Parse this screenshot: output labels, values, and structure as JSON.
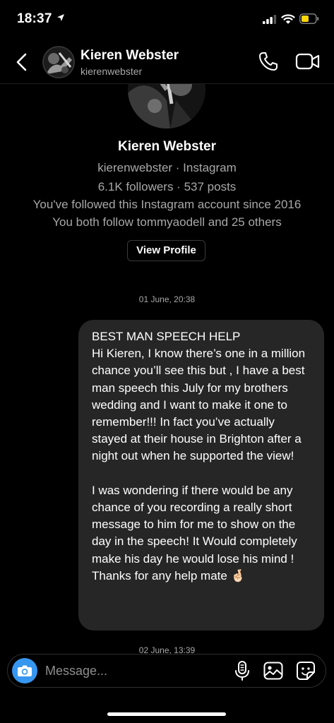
{
  "status_bar": {
    "time": "18:37"
  },
  "header": {
    "name": "Kieren Webster",
    "username": "kierenwebster"
  },
  "profile": {
    "name": "Kieren Webster",
    "subtitle": "kierenwebster · Instagram",
    "stats": "6.1K followers · 537 posts",
    "followed_since": "You've followed this Instagram account since 2016",
    "mutual": "You both follow tommyaodell and 25 others",
    "view_profile_label": "View Profile"
  },
  "conversation": {
    "timestamps": [
      "01 June, 20:38",
      "02 June, 13:39"
    ],
    "messages": [
      {
        "text": "BEST MAN SPEECH HELP\nHi Kieren, I know there’s one in a million chance you’ll see this but , I have a best man speech this July for my brothers wedding and I want to make it one to remember!!! In fact you’ve actually stayed at their house in Brighton after a night out when he supported the view!\n\nI was wondering if there would be any chance of you recording a really short message to him for me to show on the day in the speech! It Would completely make his day he would lose his mind ! Thanks for any help mate 🤞🏻"
      }
    ]
  },
  "composer": {
    "placeholder": "Message..."
  },
  "icons": {
    "back": "chevron-left-icon",
    "call": "phone-icon",
    "video": "video-camera-icon",
    "camera": "camera-icon",
    "mic": "microphone-icon",
    "gallery": "image-icon",
    "sticker": "sticker-icon"
  },
  "colors": {
    "accent": "#3797f0",
    "bubble": "#262626",
    "battery": "#ffd60a"
  }
}
